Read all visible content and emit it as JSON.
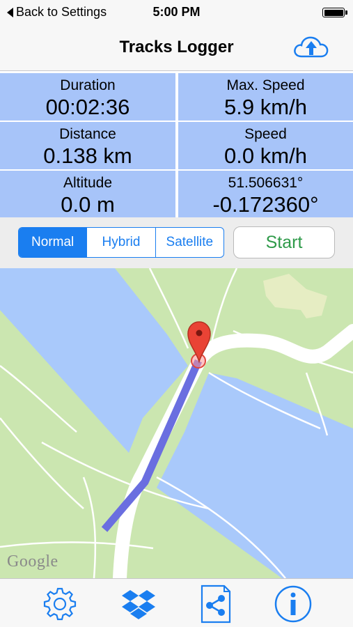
{
  "status_bar": {
    "back_label": "Back to Settings",
    "time": "5:00 PM"
  },
  "nav": {
    "title": "Tracks Logger",
    "upload_icon": "cloud-upload-icon"
  },
  "stats": {
    "duration": {
      "label": "Duration",
      "value": "00:02:36"
    },
    "max_speed": {
      "label": "Max. Speed",
      "value": "5.9 km/h"
    },
    "distance": {
      "label": "Distance",
      "value": "0.138 km"
    },
    "speed": {
      "label": "Speed",
      "value": "0.0 km/h"
    },
    "altitude": {
      "label": "Altitude",
      "value": "0.0 m"
    },
    "latitude": "51.506631°",
    "longitude": "-0.172360°"
  },
  "map_controls": {
    "map_types": [
      "Normal",
      "Hybrid",
      "Satellite"
    ],
    "selected_map_type": "Normal",
    "start_label": "Start"
  },
  "map": {
    "attribution": "Google",
    "marker_icon": "map-pin-icon"
  },
  "tab_bar": {
    "icons": [
      "settings-gear-icon",
      "dropbox-icon",
      "share-file-icon",
      "info-icon"
    ]
  },
  "colors": {
    "accent": "#1a7ef0",
    "stat_background": "#a7c4f9",
    "start_text": "#2e9a49",
    "track": "#6a6ee0",
    "water": "#a9c9fb",
    "park": "#cbe6b0"
  }
}
